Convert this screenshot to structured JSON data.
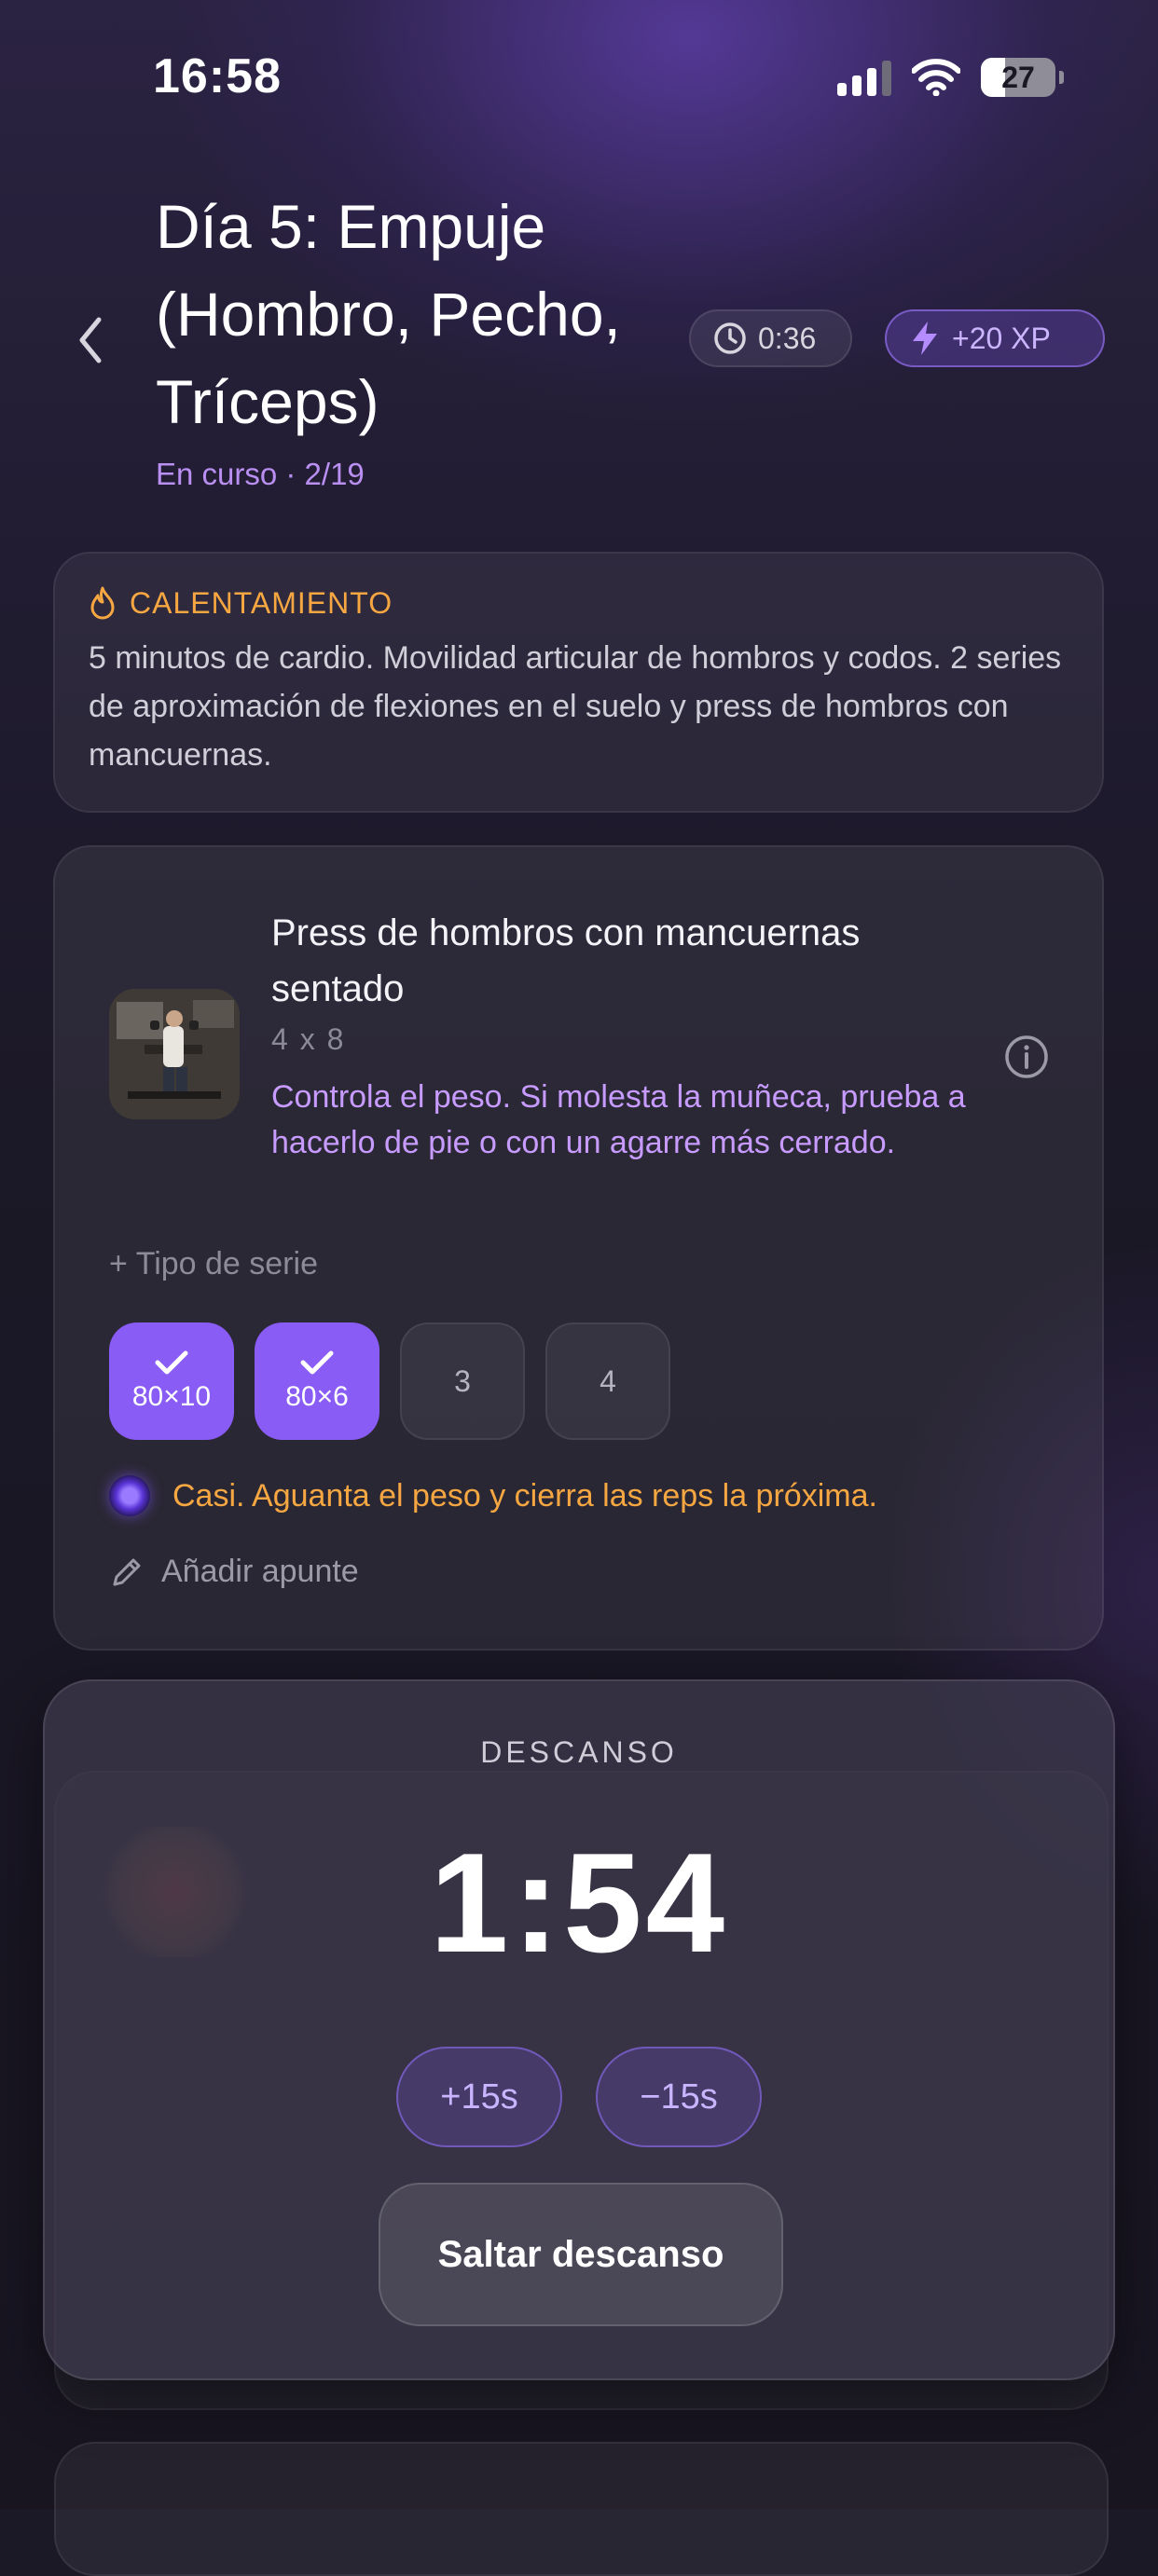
{
  "status_bar": {
    "time": "16:58",
    "battery": "27"
  },
  "header": {
    "title": "Día 5: Empuje (Hombro, Pecho, Tríceps)",
    "subtitle": "En curso · 2/19",
    "timer": "0:36",
    "xp": "+20 XP"
  },
  "warmup": {
    "label": "CALENTAMIENTO",
    "text": "5 minutos de cardio. Movilidad articular de hombros y codos. 2 series de aproximación de flexiones en el suelo y press de hombros con mancuernas."
  },
  "exercise": {
    "name": "Press de hombros con mancuernas sentado",
    "sets_reps": "4 x 8",
    "note": "Controla el peso. Si molesta la muñeca, prueba a hacerlo de pie o con un agarre más cerrado.",
    "series_type_label": "+ Tipo de serie",
    "sets": [
      {
        "label": "80×10",
        "done": true
      },
      {
        "label": "80×6",
        "done": true
      },
      {
        "label": "3",
        "done": false
      },
      {
        "label": "4",
        "done": false
      }
    ],
    "tip": "Casi. Aguanta el peso y cierra las reps la próxima.",
    "add_note_label": "Añadir apunte"
  },
  "rest": {
    "label": "DESCANSO",
    "time": "1:54",
    "plus_label": "+15s",
    "minus_label": "−15s",
    "skip_label": "Saltar descanso"
  },
  "colors": {
    "accent": "#8a5cf6",
    "accent_text": "#c79bff",
    "warning": "#f6a742",
    "background": "#1c1927"
  },
  "icons": {
    "back": "chevron-left-icon",
    "timer": "clock-icon",
    "xp": "lightning-icon",
    "warmup": "flame-icon",
    "info": "info-icon",
    "set_done": "check-icon",
    "note": "pencil-icon",
    "tip": "orb-icon"
  }
}
